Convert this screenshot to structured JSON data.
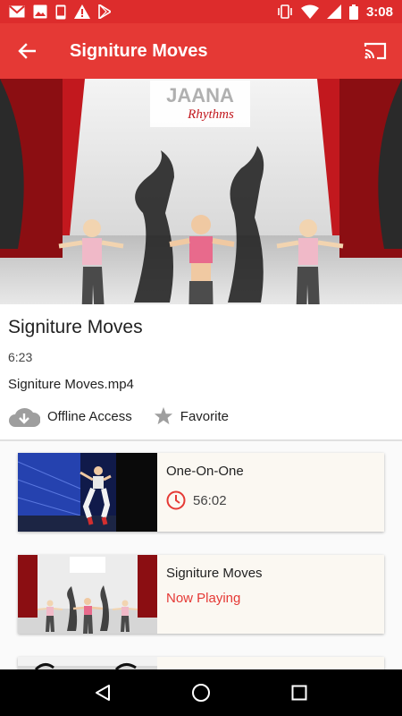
{
  "status_bar": {
    "time": "3:08",
    "left_icons": [
      "gmail-icon",
      "image-icon",
      "phone-icon",
      "warning-icon",
      "play-store-icon"
    ],
    "right_icons": [
      "vibrate-icon",
      "wifi-icon",
      "signal-icon",
      "battery-icon"
    ]
  },
  "app_bar": {
    "title": "Signiture Moves",
    "back_icon": "arrow-back-icon",
    "cast_icon": "cast-icon"
  },
  "hero": {
    "backdrop_logo_line1": "JAANA",
    "backdrop_logo_line2": "Rhythms"
  },
  "video": {
    "title": "Signiture Moves",
    "duration": "6:23",
    "filename": "Signiture Moves.mp4",
    "offline_label": "Offline Access",
    "favorite_label": "Favorite"
  },
  "list": [
    {
      "title": "One-On-One",
      "duration": "56:02",
      "status": ""
    },
    {
      "title": "Signiture Moves",
      "duration": "",
      "status": "Now Playing"
    }
  ],
  "colors": {
    "primary": "#e53935",
    "status_bar": "#dd2c2c",
    "accent_text": "#e53935",
    "card_bg": "#fbf8f2"
  }
}
